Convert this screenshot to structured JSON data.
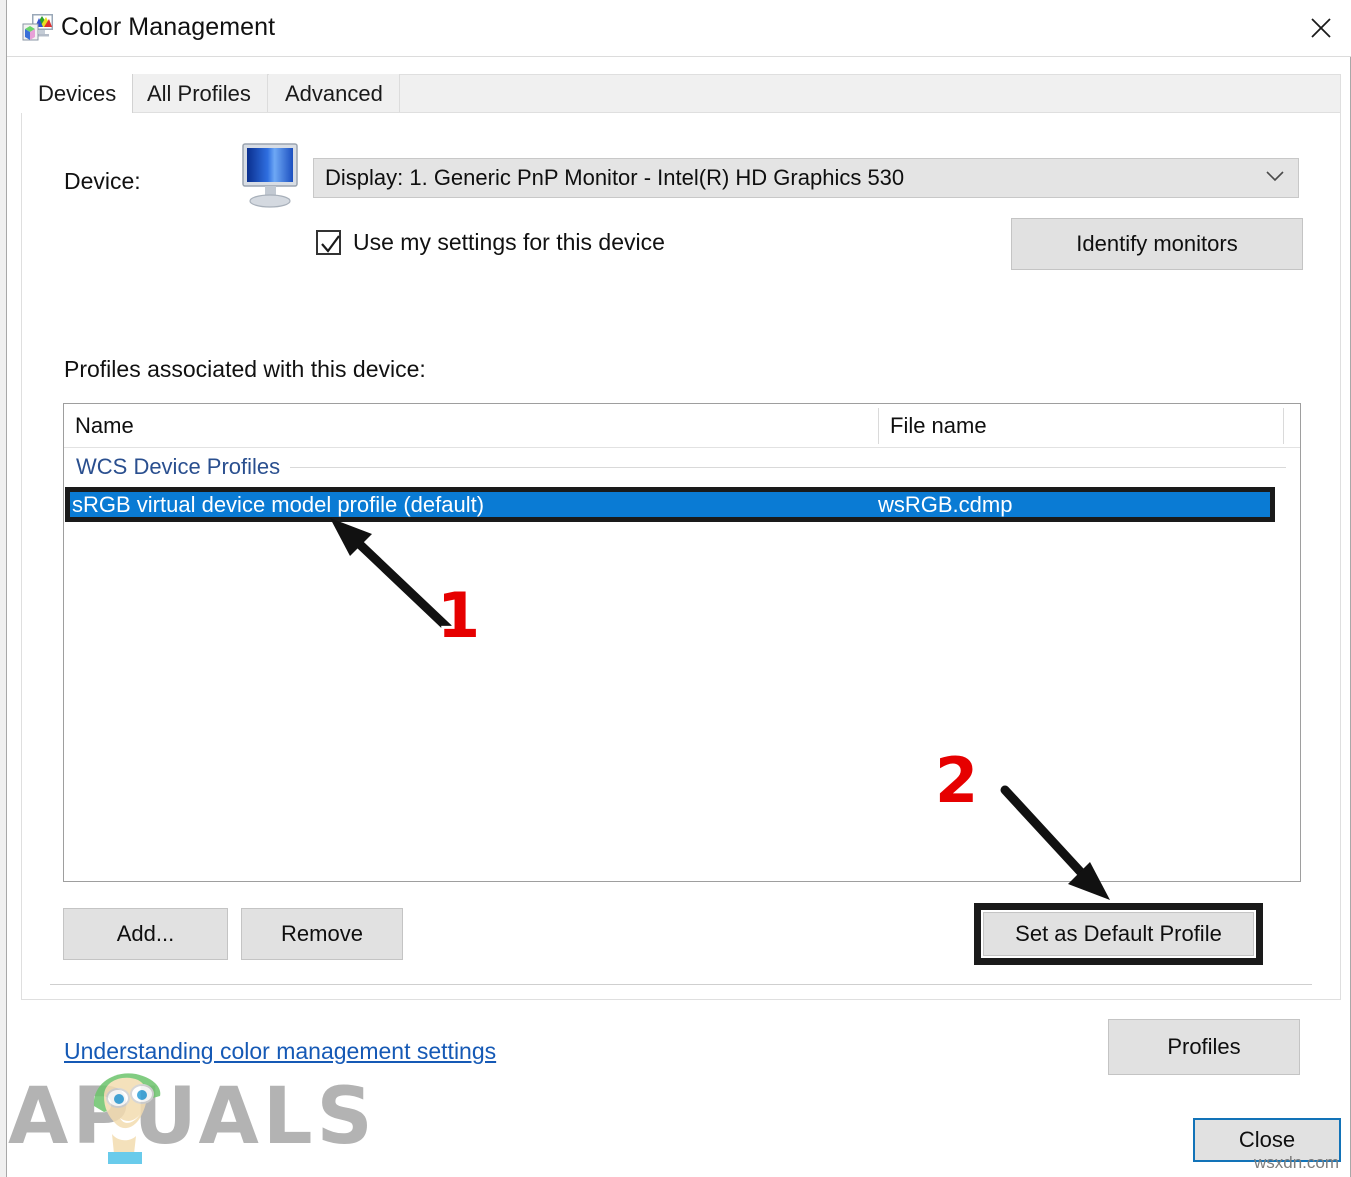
{
  "window": {
    "title": "Color Management",
    "icon": "color-management-icon",
    "close_icon": "close-icon"
  },
  "tabs": [
    {
      "label": "Devices",
      "active": true
    },
    {
      "label": "All Profiles",
      "active": false
    },
    {
      "label": "Advanced",
      "active": false
    }
  ],
  "device": {
    "label": "Device:",
    "icon": "monitor-icon",
    "selected": "Display: 1. Generic PnP Monitor - Intel(R) HD Graphics 530",
    "chevron": "chevron-down-icon",
    "checkbox": {
      "label": "Use my settings for this device",
      "checked": true
    },
    "identify_button": "Identify monitors"
  },
  "profiles": {
    "caption": "Profiles associated with this device:",
    "columns": [
      "Name",
      "File name"
    ],
    "group": "WCS Device Profiles",
    "rows": [
      {
        "name": "sRGB virtual device model profile (default)",
        "file": "wsRGB.cdmp",
        "selected": true
      }
    ],
    "add_button": "Add...",
    "remove_button": "Remove",
    "set_default_button": "Set as Default Profile"
  },
  "footer": {
    "help_link": "Understanding color management settings",
    "profiles_button": "Profiles",
    "close_button": "Close"
  },
  "annotations": [
    {
      "number": "1",
      "target": "selected-profile-row"
    },
    {
      "number": "2",
      "target": "set-as-default-profile-button"
    }
  ],
  "watermarks": {
    "brand": "APUALS",
    "site": "wsxdn.com"
  },
  "colors": {
    "selection_blue": "#0a7bd4",
    "link_blue": "#1559b5",
    "group_blue": "#2a4f8f",
    "annotation_red": "#e60000",
    "annotation_black": "#1a1a1a",
    "focus_border": "#1273b8"
  }
}
